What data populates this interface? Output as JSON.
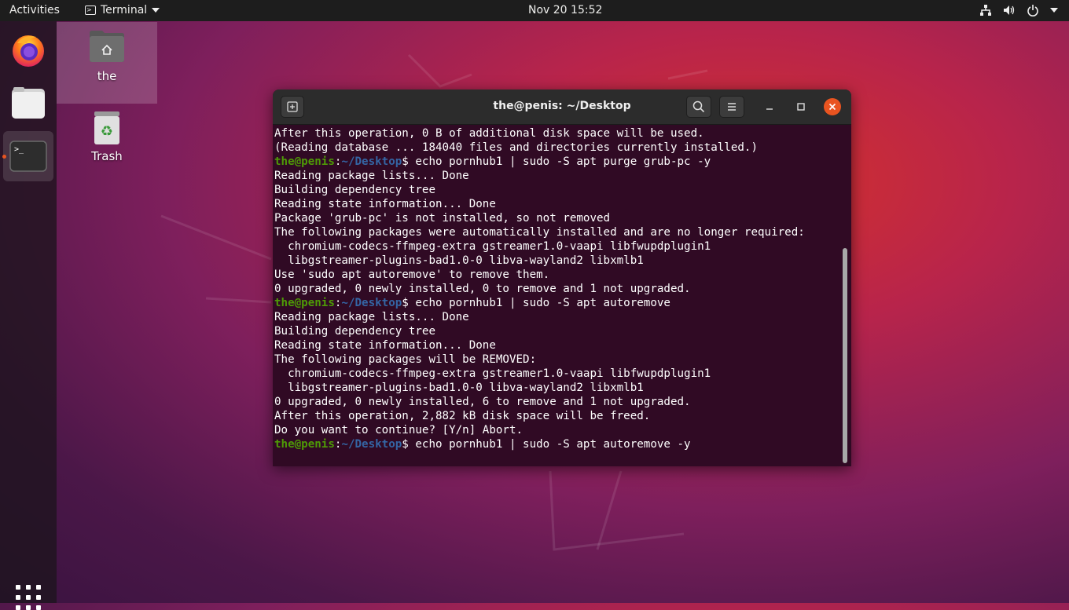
{
  "topbar": {
    "activities": "Activities",
    "app_name": "Terminal",
    "clock": "Nov 20  15:52"
  },
  "desktop": {
    "home_icon_label": "the",
    "trash_icon_label": "Trash"
  },
  "terminal": {
    "title": "the@penis: ~/Desktop",
    "prompt_user": "the@penis",
    "prompt_path": "~/Desktop",
    "lines": [
      {
        "type": "out",
        "text": "After this operation, 0 B of additional disk space will be used."
      },
      {
        "type": "out",
        "text": "(Reading database ... 184040 files and directories currently installed.)"
      },
      {
        "type": "cmd",
        "text": "echo pornhub1 | sudo -S apt purge grub-pc -y"
      },
      {
        "type": "out",
        "text": "Reading package lists... Done"
      },
      {
        "type": "out",
        "text": "Building dependency tree"
      },
      {
        "type": "out",
        "text": "Reading state information... Done"
      },
      {
        "type": "out",
        "text": "Package 'grub-pc' is not installed, so not removed"
      },
      {
        "type": "out",
        "text": "The following packages were automatically installed and are no longer required:"
      },
      {
        "type": "out",
        "text": "  chromium-codecs-ffmpeg-extra gstreamer1.0-vaapi libfwupdplugin1"
      },
      {
        "type": "out",
        "text": "  libgstreamer-plugins-bad1.0-0 libva-wayland2 libxmlb1"
      },
      {
        "type": "out",
        "text": "Use 'sudo apt autoremove' to remove them."
      },
      {
        "type": "out",
        "text": "0 upgraded, 0 newly installed, 0 to remove and 1 not upgraded."
      },
      {
        "type": "cmd",
        "text": "echo pornhub1 | sudo -S apt autoremove"
      },
      {
        "type": "out",
        "text": "Reading package lists... Done"
      },
      {
        "type": "out",
        "text": "Building dependency tree"
      },
      {
        "type": "out",
        "text": "Reading state information... Done"
      },
      {
        "type": "out",
        "text": "The following packages will be REMOVED:"
      },
      {
        "type": "out",
        "text": "  chromium-codecs-ffmpeg-extra gstreamer1.0-vaapi libfwupdplugin1"
      },
      {
        "type": "out",
        "text": "  libgstreamer-plugins-bad1.0-0 libva-wayland2 libxmlb1"
      },
      {
        "type": "out",
        "text": "0 upgraded, 0 newly installed, 6 to remove and 1 not upgraded."
      },
      {
        "type": "out",
        "text": "After this operation, 2,882 kB disk space will be freed."
      },
      {
        "type": "out",
        "text": "Do you want to continue? [Y/n] Abort."
      },
      {
        "type": "cmd",
        "text": "echo pornhub1 | sudo -S apt autoremove -y"
      }
    ]
  },
  "colors": {
    "accent": "#e95420",
    "terminal_bg": "#300a24",
    "prompt_user": "#4e9a06",
    "prompt_path": "#3465a4"
  }
}
